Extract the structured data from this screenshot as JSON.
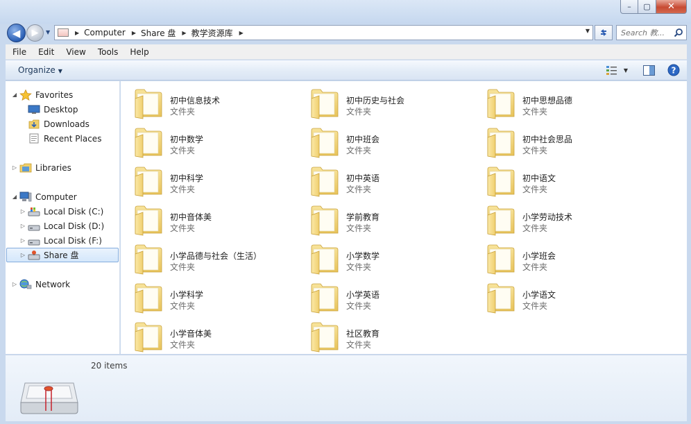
{
  "window": {
    "controls": {
      "minimize": "–",
      "maximize": "▢",
      "close": "✕"
    }
  },
  "nav": {
    "back": "◀",
    "forward": "▶",
    "breadcrumb": [
      "Computer",
      "Share 盘",
      "教学资源库"
    ],
    "search_placeholder": "Search 教..."
  },
  "menu": [
    "File",
    "Edit",
    "View",
    "Tools",
    "Help"
  ],
  "command_bar": {
    "organize": "Organize"
  },
  "sidebar": {
    "favorites": {
      "label": "Favorites",
      "items": [
        "Desktop",
        "Downloads",
        "Recent Places"
      ]
    },
    "libraries": {
      "label": "Libraries"
    },
    "computer": {
      "label": "Computer",
      "items": [
        "Local Disk (C:)",
        "Local Disk (D:)",
        "Local Disk (F:)",
        "Share 盘"
      ]
    },
    "network": {
      "label": "Network"
    }
  },
  "folders": [
    {
      "name": "初中信息技术",
      "type": "文件夹"
    },
    {
      "name": "初中历史与社会",
      "type": "文件夹"
    },
    {
      "name": "初中思想品德",
      "type": "文件夹"
    },
    {
      "name": "初中数学",
      "type": "文件夹"
    },
    {
      "name": "初中班会",
      "type": "文件夹"
    },
    {
      "name": "初中社会思品",
      "type": "文件夹"
    },
    {
      "name": "初中科学",
      "type": "文件夹"
    },
    {
      "name": "初中英语",
      "type": "文件夹"
    },
    {
      "name": "初中语文",
      "type": "文件夹"
    },
    {
      "name": "初中音体美",
      "type": "文件夹"
    },
    {
      "name": "学前教育",
      "type": "文件夹"
    },
    {
      "name": "小学劳动技术",
      "type": "文件夹"
    },
    {
      "name": "小学品德与社会（生活）",
      "type": "文件夹"
    },
    {
      "name": "小学数学",
      "type": "文件夹"
    },
    {
      "name": "小学班会",
      "type": "文件夹"
    },
    {
      "name": "小学科学",
      "type": "文件夹"
    },
    {
      "name": "小学英语",
      "type": "文件夹"
    },
    {
      "name": "小学语文",
      "type": "文件夹"
    },
    {
      "name": "小学音体美",
      "type": "文件夹"
    },
    {
      "name": "社区教育",
      "type": "文件夹"
    }
  ],
  "details": {
    "count": "20 items"
  },
  "colors": {
    "folder": "#f3d77a",
    "selection": "#d4e7fb",
    "accent": "#2a5fb5"
  }
}
